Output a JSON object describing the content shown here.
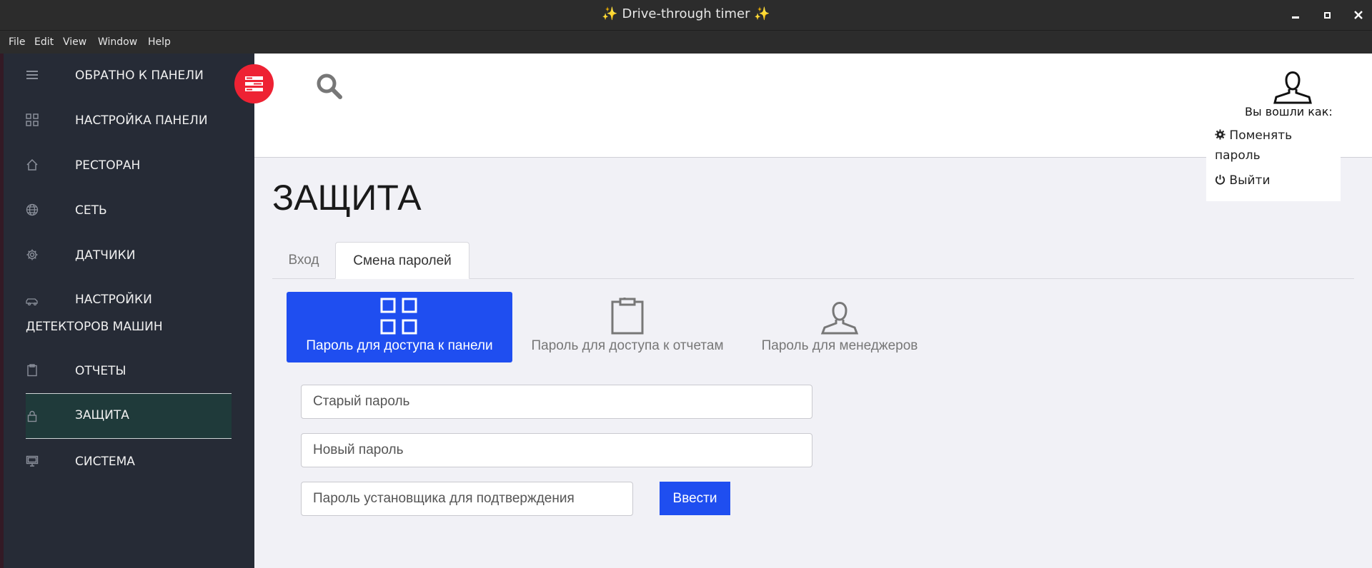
{
  "window": {
    "title_sparkle_left": "✨",
    "title": "Drive-through timer",
    "title_sparkle_right": "✨"
  },
  "menubar": [
    "File",
    "Edit",
    "View",
    "Window",
    "Help"
  ],
  "sidebar": {
    "items": [
      {
        "label": "ОБРАТНО К ПАНЕЛИ",
        "icon": "hamburger-icon"
      },
      {
        "label": "НАСТРОЙКА ПАНЕЛИ",
        "icon": "grid-icon"
      },
      {
        "label": "РЕСТОРАН",
        "icon": "home-icon"
      },
      {
        "label": "СЕТЬ",
        "icon": "globe-icon"
      },
      {
        "label": "ДАТЧИКИ",
        "icon": "gear-icon"
      },
      {
        "label": "НАСТРОЙКИ",
        "label2": "ДЕТЕКТОРОВ МАШИН",
        "icon": "car-icon"
      },
      {
        "label": "ОТЧЕТЫ",
        "icon": "clipboard-icon"
      },
      {
        "label": "ЗАЩИТА",
        "icon": "lock-icon",
        "active": true
      },
      {
        "label": "СИСТЕМА",
        "icon": "monitor-icon"
      }
    ]
  },
  "header": {
    "logged_in_as": "Вы вошли как:"
  },
  "user_menu": {
    "change_password": "Поменять пароль",
    "logout": "Выйти"
  },
  "page": {
    "title": "ЗАЩИТА",
    "tabs": [
      {
        "label": "Вход",
        "active": false
      },
      {
        "label": "Смена паролей",
        "active": true
      }
    ],
    "password_types": [
      {
        "label": "Пароль для доступа к панели",
        "icon": "grid-icon",
        "active": true
      },
      {
        "label": "Пароль для доступа к отчетам",
        "icon": "clipboard-icon",
        "active": false
      },
      {
        "label": "Пароль для менеджеров",
        "icon": "user-icon",
        "active": false
      }
    ],
    "form": {
      "old_password_placeholder": "Старый пароль",
      "new_password_placeholder": "Новый пароль",
      "installer_password_placeholder": "Пароль установщика для подтверждения",
      "submit_label": "Ввести"
    }
  },
  "colors": {
    "accent": "#1f4ef0",
    "sidebar_bg": "#262b36",
    "fab": "#ee2233"
  }
}
